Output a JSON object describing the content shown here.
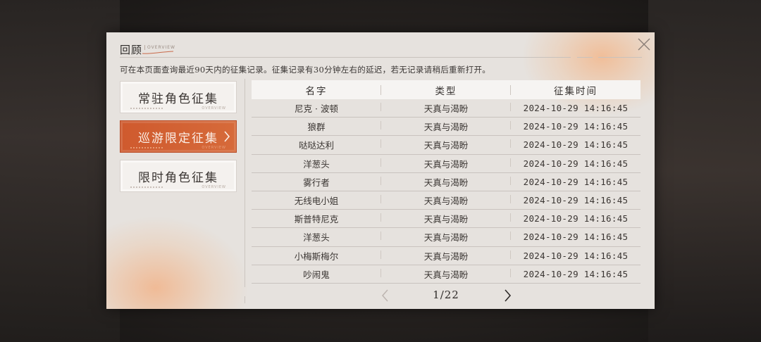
{
  "header": {
    "title": "回顾",
    "subtitle": "OVERVIEW"
  },
  "notice": "可在本页面查询最近90天内的征集记录。征集记录有30分钟左右的延迟，若无记录请稍后重新打开。",
  "categories": [
    {
      "label": "常驻角色征集",
      "deco": "OVERVIEW",
      "active": false
    },
    {
      "label": "巡游限定征集",
      "deco": "OVERVIEW",
      "active": true
    },
    {
      "label": "限时角色征集",
      "deco": "OVERVIEW",
      "active": false
    }
  ],
  "table": {
    "headers": [
      "名字",
      "类型",
      "征集时间"
    ],
    "rows": [
      {
        "name": "尼克 · 波顿",
        "type": "天真与渴盼",
        "time": "2024-10-29 14:16:45"
      },
      {
        "name": "狼群",
        "type": "天真与渴盼",
        "time": "2024-10-29 14:16:45"
      },
      {
        "name": "哒哒达利",
        "type": "天真与渴盼",
        "time": "2024-10-29 14:16:45"
      },
      {
        "name": "洋葱头",
        "type": "天真与渴盼",
        "time": "2024-10-29 14:16:45"
      },
      {
        "name": "雾行者",
        "type": "天真与渴盼",
        "time": "2024-10-29 14:16:45"
      },
      {
        "name": "无线电小姐",
        "type": "天真与渴盼",
        "time": "2024-10-29 14:16:45"
      },
      {
        "name": "斯普特尼克",
        "type": "天真与渴盼",
        "time": "2024-10-29 14:16:45"
      },
      {
        "name": "洋葱头",
        "type": "天真与渴盼",
        "time": "2024-10-29 14:16:45"
      },
      {
        "name": "小梅斯梅尔",
        "type": "天真与渴盼",
        "time": "2024-10-29 14:16:45"
      },
      {
        "name": "吵闹鬼",
        "type": "天真与渴盼",
        "time": "2024-10-29 14:16:45"
      }
    ]
  },
  "pager": {
    "text": "1/22"
  },
  "icons": {
    "close": "close-icon",
    "prev": "chevron-left-icon",
    "next": "chevron-right-icon",
    "active_arrow": "chevron-right-icon"
  },
  "colors": {
    "accent": "#d0602f",
    "panel": "#e6e2de",
    "text": "#3a3532"
  }
}
